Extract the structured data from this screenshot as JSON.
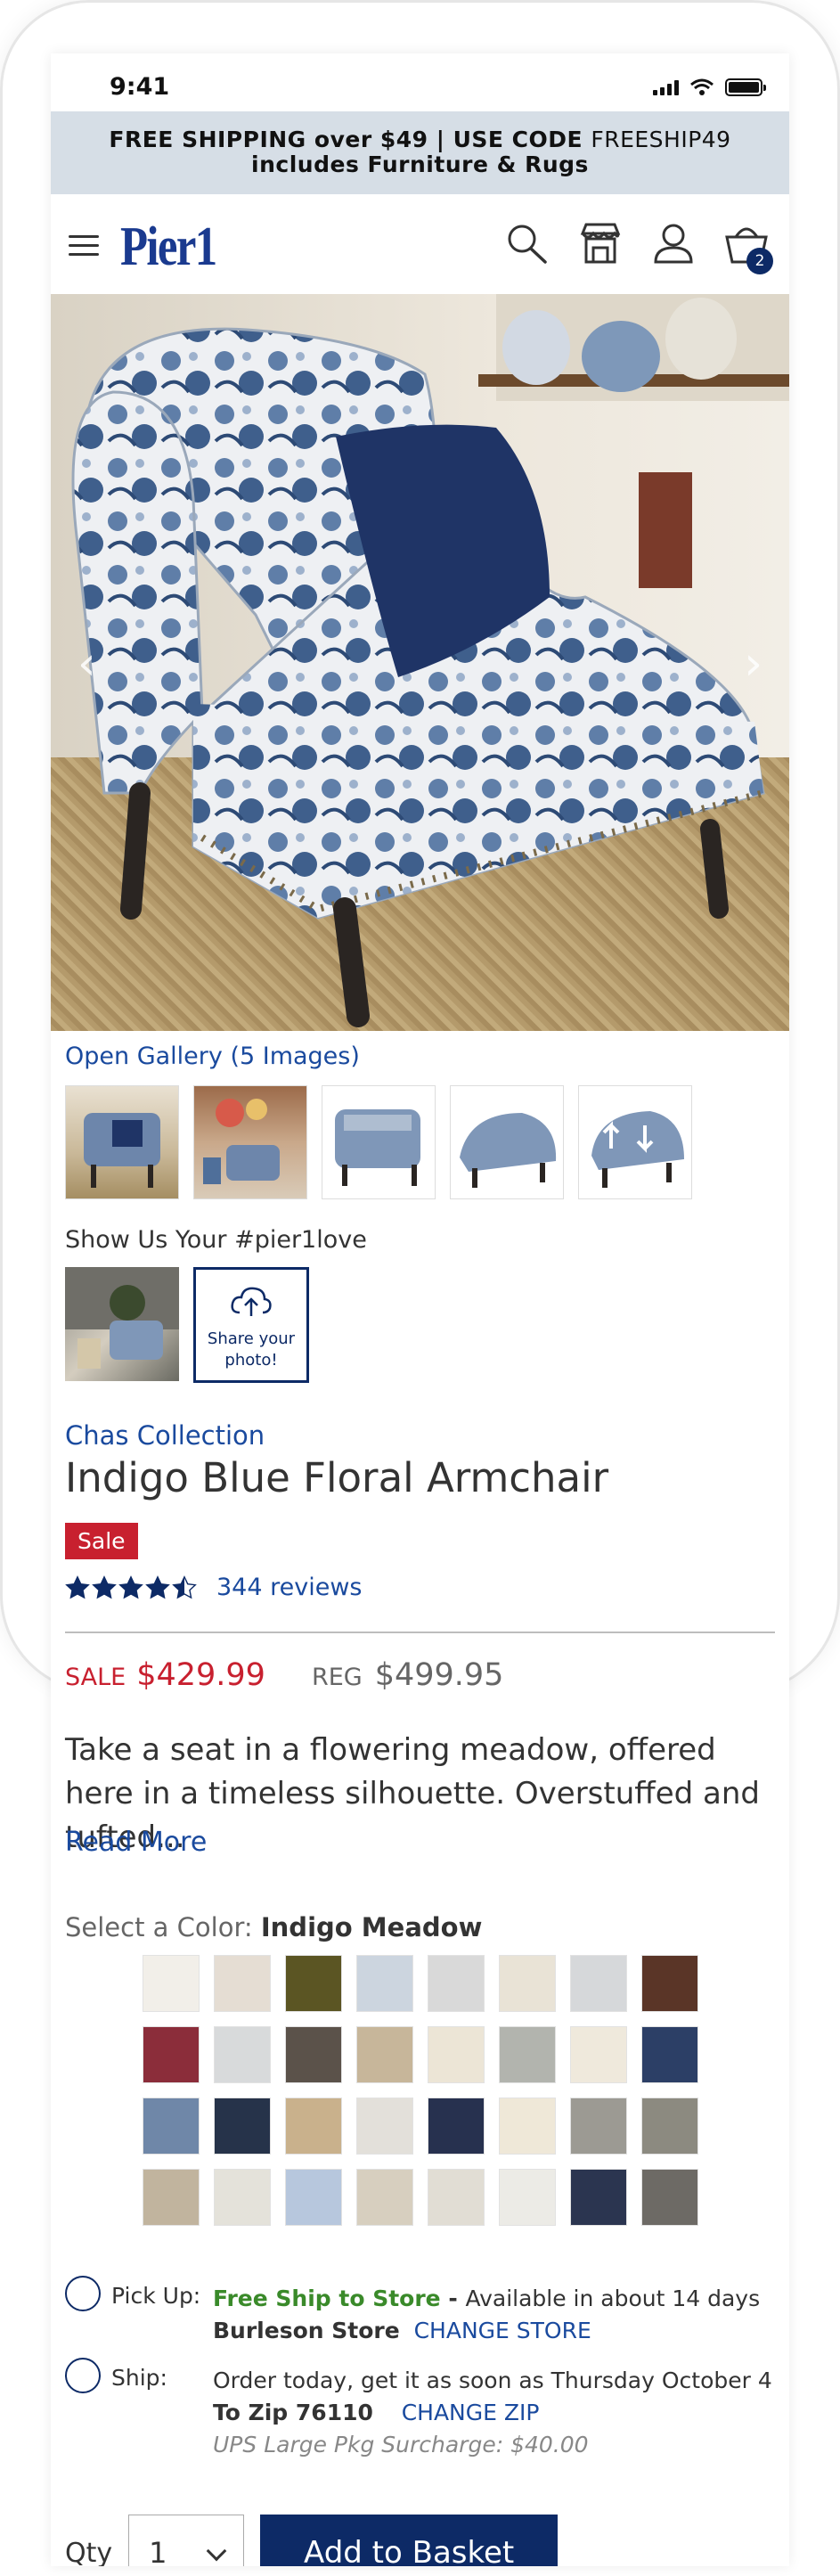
{
  "status_bar": {
    "time": "9:41"
  },
  "promo": {
    "line1_bold": "FREE SHIPPING over $49 | USE CODE ",
    "line1_code": "FREESHIP49",
    "line2": "includes Furniture & Rugs"
  },
  "header": {
    "logo": "Pier1",
    "cart_count": "2",
    "icons": [
      "menu-icon",
      "search-icon",
      "store-icon",
      "account-icon",
      "basket-icon"
    ]
  },
  "gallery": {
    "open_link": "Open Gallery (5 Images)",
    "thumbnail_count": 5
  },
  "ugc": {
    "label": "Show Us Your #pier1love",
    "share_text_1": "Share your",
    "share_text_2": "photo!"
  },
  "product": {
    "collection": "Chas Collection",
    "title": "Indigo Blue Floral Armchair",
    "badge": "Sale",
    "rating": 4.5,
    "reviews": "344 reviews",
    "sale_label": "SALE",
    "sale_price": "$429.99",
    "reg_label": "REG",
    "reg_price": "$499.95",
    "description": "Take a seat in a flowering meadow, offered here in a timeless silhouette. Overstuffed and tufted...",
    "read_more": "Read More"
  },
  "color": {
    "label": "Select a Color: ",
    "selected": "Indigo Meadow",
    "swatches": [
      "#f2efe9",
      "#e5ddd3",
      "#5b5523",
      "#ccd5df",
      "#d9d9d9",
      "#e9e3d6",
      "#d6d8da",
      "#5a3527",
      "#8b2d3a",
      "#d8dadb",
      "#5b524a",
      "#c7b69a",
      "#ece5d6",
      "#b2b4ae",
      "#efe9dc",
      "#2c3f66",
      "#6f87a8",
      "#26334a",
      "#c9b18c",
      "#e3e0da",
      "#27314f",
      "#efe8d8",
      "#9c9a93",
      "#8c8a80",
      "#c1b49e",
      "#e4e2da",
      "#b7c7dd",
      "#d7cfbf",
      "#e1ddd4",
      "#ecebe6",
      "#2b3550",
      "#6d6a65"
    ]
  },
  "fulfilment": {
    "pickup_label": "Pick Up:",
    "pickup_free": "Free Ship to Store",
    "pickup_sep": " - ",
    "pickup_avail": "Available in about 14 days",
    "pickup_store": "Burleson Store",
    "pickup_change": "CHANGE STORE",
    "ship_label": "Ship:",
    "ship_text": "Order today, get it as soon as Thursday October 4",
    "ship_zip": "To Zip 76110",
    "ship_change": "CHANGE ZIP",
    "ship_surcharge": "UPS Large Pkg Surcharge: $40.00"
  },
  "purchase": {
    "qty_label": "Qty",
    "qty_value": "1",
    "add_button": "Add to Basket"
  }
}
